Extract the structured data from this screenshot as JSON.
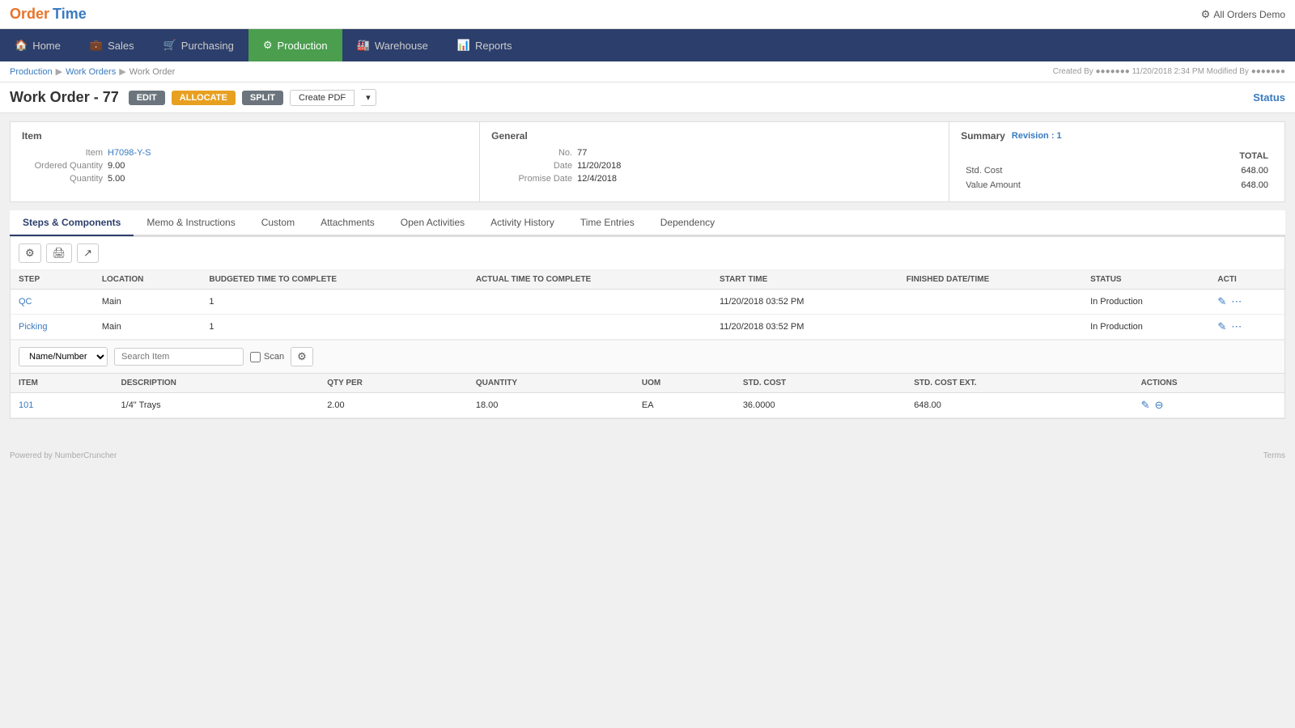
{
  "app": {
    "logo_order": "Order",
    "logo_time": "Time",
    "top_right": "All Orders Demo"
  },
  "nav": {
    "items": [
      {
        "label": "Home",
        "icon": "🏠",
        "active": false
      },
      {
        "label": "Sales",
        "icon": "💼",
        "active": false
      },
      {
        "label": "Purchasing",
        "icon": "🛒",
        "active": false
      },
      {
        "label": "Production",
        "icon": "⚙",
        "active": true
      },
      {
        "label": "Warehouse",
        "icon": "🏭",
        "active": false
      },
      {
        "label": "Reports",
        "icon": "📊",
        "active": false
      }
    ]
  },
  "breadcrumb": {
    "items": [
      "Production",
      "Work Orders",
      "Work Order"
    ],
    "created_info": "Created By ●●●●●●● 11/20/2018 2:34 PM   Modified By ●●●●●●●"
  },
  "page": {
    "title": "Work Order - 77",
    "btn_edit": "EDIT",
    "btn_allocate": "ALLOCATE",
    "btn_split": "SPLIT",
    "btn_pdf": "Create PDF",
    "status_label": "Status"
  },
  "item_card": {
    "title": "Item",
    "item_label": "Item",
    "item_value": "H7098-Y-S",
    "ordered_qty_label": "Ordered Quantity",
    "ordered_qty_value": "9.00",
    "quantity_label": "Quantity",
    "quantity_value": "5.00"
  },
  "general_card": {
    "title": "General",
    "no_label": "No.",
    "no_value": "77",
    "date_label": "Date",
    "date_value": "11/20/2018",
    "promise_date_label": "Promise Date",
    "promise_date_value": "12/4/2018"
  },
  "summary_card": {
    "title": "Summary",
    "revision": "Revision : 1",
    "col_total": "TOTAL",
    "std_cost_label": "Std. Cost",
    "std_cost_value": "648.00",
    "value_amount_label": "Value Amount",
    "value_amount_value": "648.00"
  },
  "tabs": [
    {
      "label": "Steps & Components",
      "active": true
    },
    {
      "label": "Memo & Instructions",
      "active": false
    },
    {
      "label": "Custom",
      "active": false
    },
    {
      "label": "Attachments",
      "active": false
    },
    {
      "label": "Open Activities",
      "active": false
    },
    {
      "label": "Activity History",
      "active": false
    },
    {
      "label": "Time Entries",
      "active": false
    },
    {
      "label": "Dependency",
      "active": false
    }
  ],
  "steps_table": {
    "columns": [
      "STEP",
      "LOCATION",
      "BUDGETED TIME TO COMPLETE",
      "ACTUAL TIME TO COMPLETE",
      "START TIME",
      "FINISHED DATE/TIME",
      "STATUS",
      "ACTI"
    ],
    "rows": [
      {
        "step": "QC",
        "location": "Main",
        "budgeted_time": "1",
        "actual_time": "",
        "start_time": "11/20/2018 03:52 PM",
        "finished_datetime": "",
        "status": "In Production"
      },
      {
        "step": "Picking",
        "location": "Main",
        "budgeted_time": "1",
        "actual_time": "",
        "start_time": "11/20/2018 03:52 PM",
        "finished_datetime": "",
        "status": "In Production"
      }
    ]
  },
  "component_filter": {
    "select_options": [
      "Name/Number"
    ],
    "select_value": "Name/Number",
    "search_placeholder": "Search Item",
    "scan_label": "Scan"
  },
  "components_table": {
    "columns": [
      "ITEM",
      "DESCRIPTION",
      "QTY PER",
      "QUANTITY",
      "UOM",
      "STD. COST",
      "STD. COST EXT.",
      "ACTIONS"
    ],
    "rows": [
      {
        "item": "101",
        "description": "1/4\" Trays",
        "qty_per": "2.00",
        "quantity": "18.00",
        "uom": "EA",
        "std_cost": "36.0000",
        "std_cost_ext": "648.00"
      }
    ]
  },
  "footer": {
    "left": "Powered by NumberCruncher",
    "right": "Terms"
  }
}
